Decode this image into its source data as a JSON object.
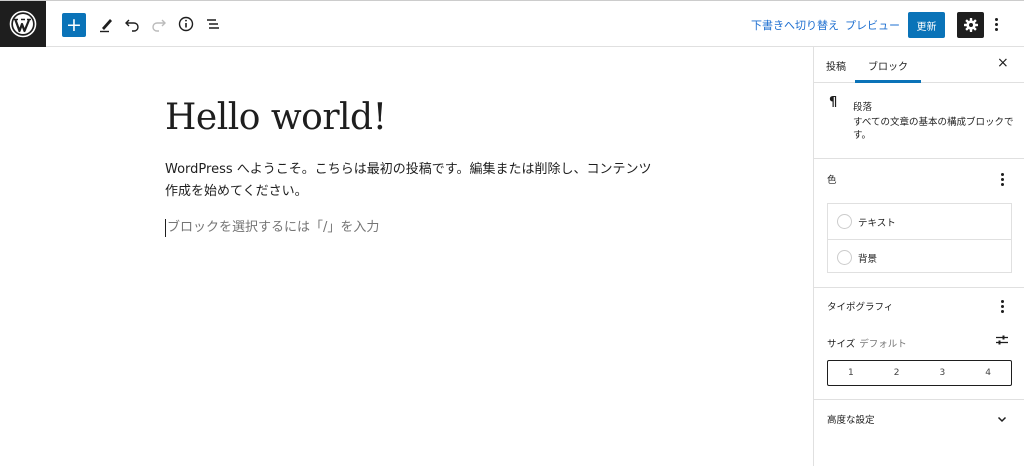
{
  "toolbar": {
    "add_label": "+",
    "draft_label": "下書きへ切り替え",
    "preview_label": "プレビュー",
    "update_label": "更新"
  },
  "post": {
    "title": "Hello world!",
    "paragraph": "WordPress へようこそ。こちらは最初の投稿です。編集または削除し、コンテンツ作成を始めてください。",
    "placeholder": "ブロックを選択するには「/」を入力"
  },
  "sidebar": {
    "tabs": [
      {
        "label": "投稿"
      },
      {
        "label": "ブロック"
      }
    ],
    "close_label": "×",
    "block": {
      "icon": "¶",
      "name": "段落",
      "description": "すべての文章の基本の構成ブロックです。"
    },
    "color": {
      "title": "色",
      "items": [
        {
          "label": "テキスト"
        },
        {
          "label": "背景"
        }
      ]
    },
    "typography": {
      "title": "タイポグラフィ",
      "size_label": "サイズ",
      "size_value": "デフォルト",
      "size_options": [
        "1",
        "2",
        "3",
        "4"
      ]
    },
    "advanced": {
      "title": "高度な設定"
    }
  },
  "colors": {
    "accent": "#0a73b8",
    "dark": "#1e1e1e",
    "link": "#1e6fd0"
  }
}
